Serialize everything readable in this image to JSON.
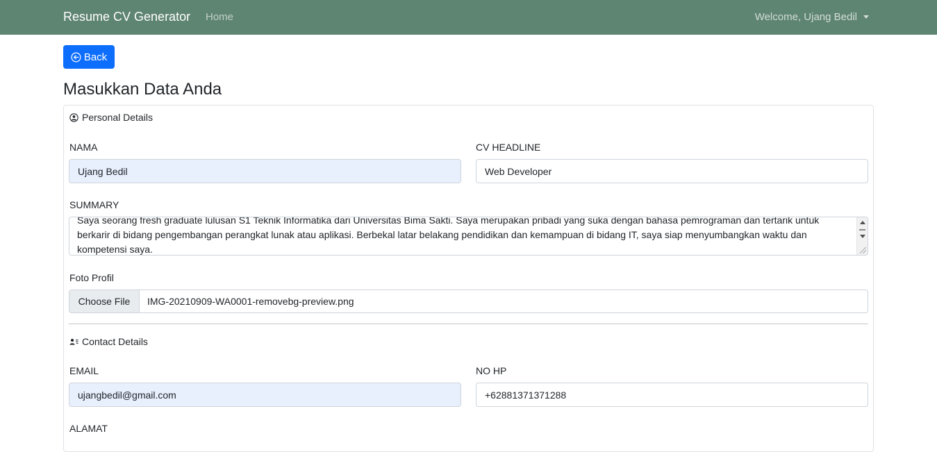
{
  "navbar": {
    "brand": "Resume CV Generator",
    "home": "Home",
    "user": "Welcome, Ujang Bedil",
    "background": "#5e8472"
  },
  "back_button": {
    "label": "Back",
    "icon": "arrow-left-circle-icon",
    "color": "#0d6efd"
  },
  "page_title": "Masukkan Data Anda",
  "personal": {
    "heading": "Personal Details",
    "icon": "person-circle-icon",
    "nama_label": "NAMA",
    "nama_value": "Ujang Bedil",
    "headline_label": "CV HEADLINE",
    "headline_value": "Web Developer",
    "summary_label": "SUMMARY",
    "summary_value": "Saya seorang fresh graduate lulusan S1 Teknik Informatika dari Universitas Bima Sakti. Saya merupakan pribadi yang suka dengan bahasa pemrograman dan tertarik untuk berkarir di bidang pengembangan perangkat lunak atau aplikasi.  Berbekal latar belakang pendidikan dan kemampuan di bidang IT, saya siap menyumbangkan waktu dan kompetensi saya.",
    "foto_label": "Foto Profil",
    "file_button": "Choose File",
    "file_name": "IMG-20210909-WA0001-removebg-preview.png"
  },
  "contact": {
    "heading": "Contact Details",
    "icon": "person-lines-icon",
    "email_label": "EMAIL",
    "email_value": "ujangbedil@gmail.com",
    "nohp_label": "NO HP",
    "nohp_value": "+62881371371288",
    "alamat_label": "ALAMAT"
  }
}
